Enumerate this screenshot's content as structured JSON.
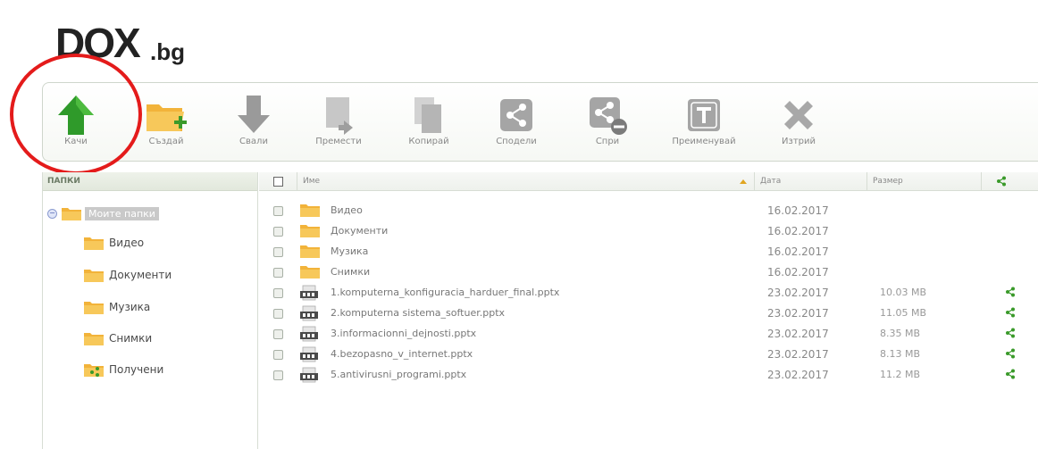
{
  "logo": {
    "main": "DOX",
    "ext": ".bg"
  },
  "toolbar": {
    "buttons": [
      {
        "key": "upload",
        "label": "Качи",
        "icon": "upload-arrow-icon"
      },
      {
        "key": "create",
        "label": "Създай",
        "icon": "new-folder-icon"
      },
      {
        "key": "download",
        "label": "Свали",
        "icon": "download-arrow-icon"
      },
      {
        "key": "move",
        "label": "Премести",
        "icon": "move-icon"
      },
      {
        "key": "copy",
        "label": "Копирай",
        "icon": "copy-icon"
      },
      {
        "key": "share",
        "label": "Сподели",
        "icon": "share-icon"
      },
      {
        "key": "unshare",
        "label": "Спри",
        "icon": "stop-share-icon"
      },
      {
        "key": "rename",
        "label": "Преименувай",
        "icon": "rename-icon"
      },
      {
        "key": "delete",
        "label": "Изтрий",
        "icon": "delete-icon"
      }
    ]
  },
  "sidebar": {
    "header": "ПАПКИ",
    "root": "Моите папки",
    "items": [
      {
        "label": "Видео",
        "icon": "folder-icon"
      },
      {
        "label": "Документи",
        "icon": "folder-icon"
      },
      {
        "label": "Музика",
        "icon": "folder-icon"
      },
      {
        "label": "Снимки",
        "icon": "folder-icon"
      },
      {
        "label": "Получени",
        "icon": "shared-folder-icon"
      }
    ]
  },
  "table": {
    "headers": {
      "name": "Име",
      "date": "Дата",
      "size": "Размер"
    },
    "rows": [
      {
        "type": "folder",
        "name": "Видео",
        "date": "16.02.2017",
        "size": "",
        "shared": false
      },
      {
        "type": "folder",
        "name": "Документи",
        "date": "16.02.2017",
        "size": "",
        "shared": false
      },
      {
        "type": "folder",
        "name": "Музика",
        "date": "16.02.2017",
        "size": "",
        "shared": false
      },
      {
        "type": "folder",
        "name": "Снимки",
        "date": "16.02.2017",
        "size": "",
        "shared": false
      },
      {
        "type": "file",
        "name": "1.komputerna_konfiguracia_harduer_final.pptx",
        "date": "23.02.2017",
        "size": "10.03 MB",
        "shared": true
      },
      {
        "type": "file",
        "name": "2.komputerna sistema_softuer.pptx",
        "date": "23.02.2017",
        "size": "11.05 MB",
        "shared": true
      },
      {
        "type": "file",
        "name": "3.informacionni_dejnosti.pptx",
        "date": "23.02.2017",
        "size": "8.35 MB",
        "shared": true
      },
      {
        "type": "file",
        "name": "4.bezopasno_v_internet.pptx",
        "date": "23.02.2017",
        "size": "8.13 MB",
        "shared": true
      },
      {
        "type": "file",
        "name": "5.antivirusni_programi.pptx",
        "date": "23.02.2017",
        "size": "11.2 MB",
        "shared": true
      }
    ]
  },
  "colors": {
    "accent_green": "#3a9a2a",
    "highlight_red": "#e41b1b",
    "folder_orange": "#f2b33a"
  }
}
